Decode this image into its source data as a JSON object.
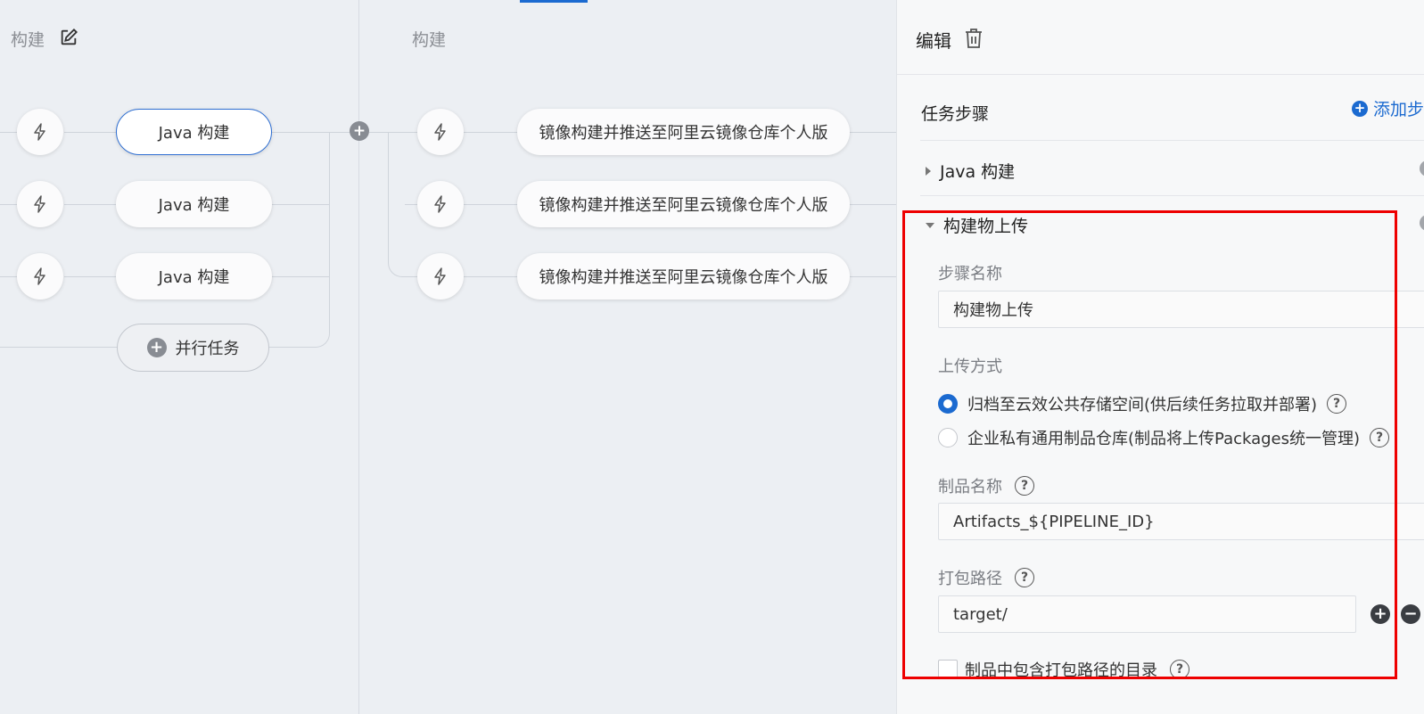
{
  "canvas": {
    "stages": [
      {
        "title": "构建"
      },
      {
        "title": "构建"
      }
    ],
    "stage1_tasks": [
      {
        "label": "Java 构建"
      },
      {
        "label": "Java 构建"
      },
      {
        "label": "Java 构建"
      }
    ],
    "stage2_tasks": [
      {
        "label": "镜像构建并推送至阿里云镜像仓库个人版"
      },
      {
        "label": "镜像构建并推送至阿里云镜像仓库个人版"
      },
      {
        "label": "镜像构建并推送至阿里云镜像仓库个人版"
      }
    ],
    "parallel_task_label": "并行任务",
    "icons": {
      "edit": "edit-icon",
      "bolt": "lightning-icon",
      "add": "plus-circle-icon"
    }
  },
  "panel": {
    "title": "编辑",
    "section_title": "任务步骤",
    "add_step_label": "添加步",
    "steps": [
      {
        "name": "Java 构建",
        "expanded": false
      },
      {
        "name": "构建物上传",
        "expanded": true
      }
    ],
    "form": {
      "step_name_label": "步骤名称",
      "step_name_value": "构建物上传",
      "upload_method_label": "上传方式",
      "upload_options": [
        {
          "label": "归档至云效公共存储空间(供后续任务拉取并部署)",
          "checked": true
        },
        {
          "label": "企业私有通用制品仓库(制品将上传Packages统一管理)",
          "checked": false
        }
      ],
      "artifact_name_label": "制品名称",
      "artifact_name_value": "Artifacts_${PIPELINE_ID}",
      "package_path_label": "打包路径",
      "package_path_value": "target/",
      "include_dir_label": "制品中包含打包路径的目录",
      "include_dir_checked": false
    },
    "colors": {
      "accent": "#1b6ad0",
      "highlight": "#ee0000"
    }
  }
}
